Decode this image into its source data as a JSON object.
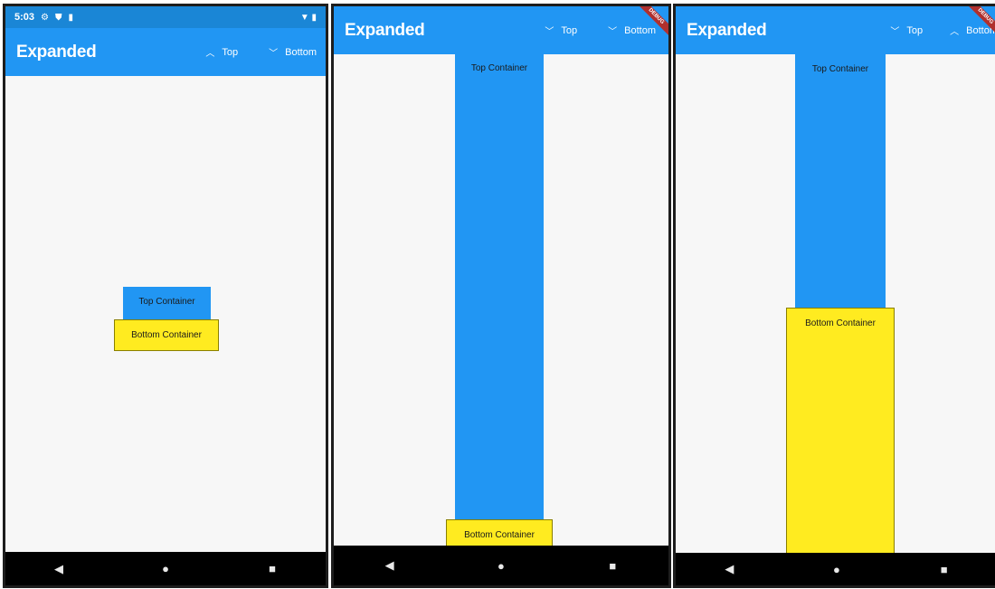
{
  "status": {
    "time": "5:03"
  },
  "app_bar": {
    "title": "Expanded",
    "ribbon": "DEBUG"
  },
  "icons": {
    "settings": "gear-icon",
    "shield": "shield-icon",
    "sd": "sd-card-icon",
    "wifi": "wifi-icon",
    "battery": "battery-icon",
    "chevron_up": "chevron-up-icon",
    "chevron_down": "chevron-down-icon",
    "back": "back-triangle-icon",
    "home": "home-circle-icon",
    "recents": "recents-square-icon"
  },
  "phones": [
    {
      "actions": [
        {
          "chevron": "^",
          "label": "Top"
        },
        {
          "chevron": "v",
          "label": "Bottom"
        }
      ],
      "top_container": "Top Container",
      "bottom_container": "Bottom Container"
    },
    {
      "actions": [
        {
          "chevron": "v",
          "label": "Top"
        },
        {
          "chevron": "v",
          "label": "Bottom"
        }
      ],
      "top_container": "Top Container",
      "bottom_container": "Bottom Container"
    },
    {
      "actions": [
        {
          "chevron": "v",
          "label": "Top"
        },
        {
          "chevron": "^",
          "label": "Bottom"
        }
      ],
      "top_container": "Top Container",
      "bottom_container": "Bottom Container"
    }
  ],
  "nav": {
    "back": "◀",
    "home": "●",
    "recents": "■"
  },
  "colors": {
    "app_bar": "#2196f3",
    "status_bar": "#1a86d6",
    "top_container": "#2196f3",
    "bottom_container": "#ffeb20",
    "background": "#f7f7f7"
  }
}
